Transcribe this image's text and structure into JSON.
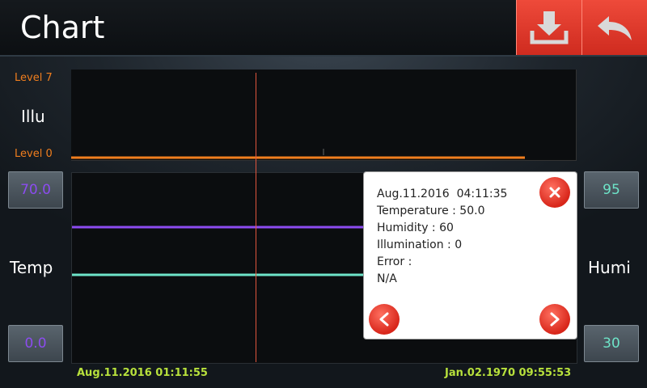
{
  "header": {
    "title": "Chart",
    "download_icon": "download-icon",
    "back_icon": "back-arrow-icon",
    "accent": "#de3a2c"
  },
  "illumination": {
    "label": "Illu",
    "level_top": "Level 7",
    "level_bottom": "Level 0",
    "color": "#f07e1e"
  },
  "left_axis": {
    "label": "Temp",
    "max_value": "70.0",
    "min_value": "0.0",
    "color": "#8c4cf0"
  },
  "right_axis": {
    "label": "Humi",
    "max_value": "95",
    "min_value": "30",
    "color": "#6ee4c8"
  },
  "timeline": {
    "start": "Aug.11.2016  01:11:55",
    "end": "Jan.02.1970  09:55:53"
  },
  "popup": {
    "datetime": "Aug.11.2016  04:11:35",
    "temperature": "Temperature : 50.0",
    "humidity": "Humidity : 60",
    "illumination": "Illumination : 0",
    "error_label": "Error :",
    "error_value": "N/A",
    "close_icon": "close-icon",
    "prev_icon": "prev-arrow-icon",
    "next_icon": "next-arrow-icon"
  }
}
